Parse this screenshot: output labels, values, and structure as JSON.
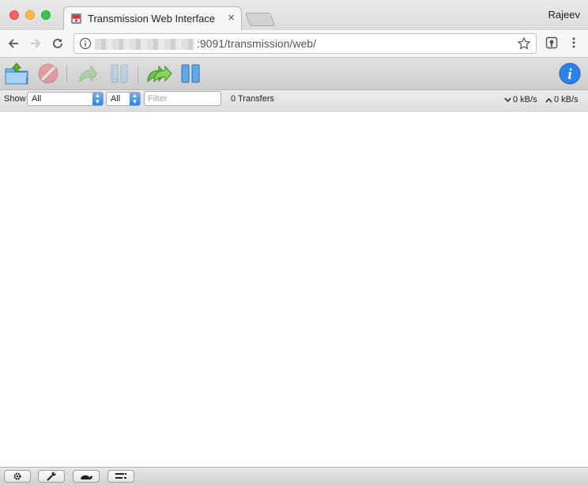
{
  "window": {
    "tab_title": "Transmission Web Interface",
    "tab_close": "×",
    "profile_name": "Rajeev"
  },
  "address_bar": {
    "url_visible": ":9091/transmission/web/",
    "host_obscured": true
  },
  "toolbar": {
    "buttons": [
      "open-torrent",
      "remove",
      "resume",
      "pause",
      "resume-all",
      "pause-all",
      "inspector"
    ]
  },
  "filter_bar": {
    "show_label": "Show",
    "state_filter": "All",
    "tracker_filter": "All",
    "filter_placeholder": "Filter",
    "transfers_count": "0 Transfers",
    "download_speed": "0 kB/s",
    "upload_speed": "0 kB/s"
  },
  "bottom_bar": {
    "buttons": [
      "settings",
      "preferences-wrench",
      "turtle-speed-limit",
      "compact-view"
    ]
  },
  "colors": {
    "accent_blue": "#2a82ea",
    "resume_green": "#4caf2a",
    "remove_red": "#e85a5a"
  }
}
